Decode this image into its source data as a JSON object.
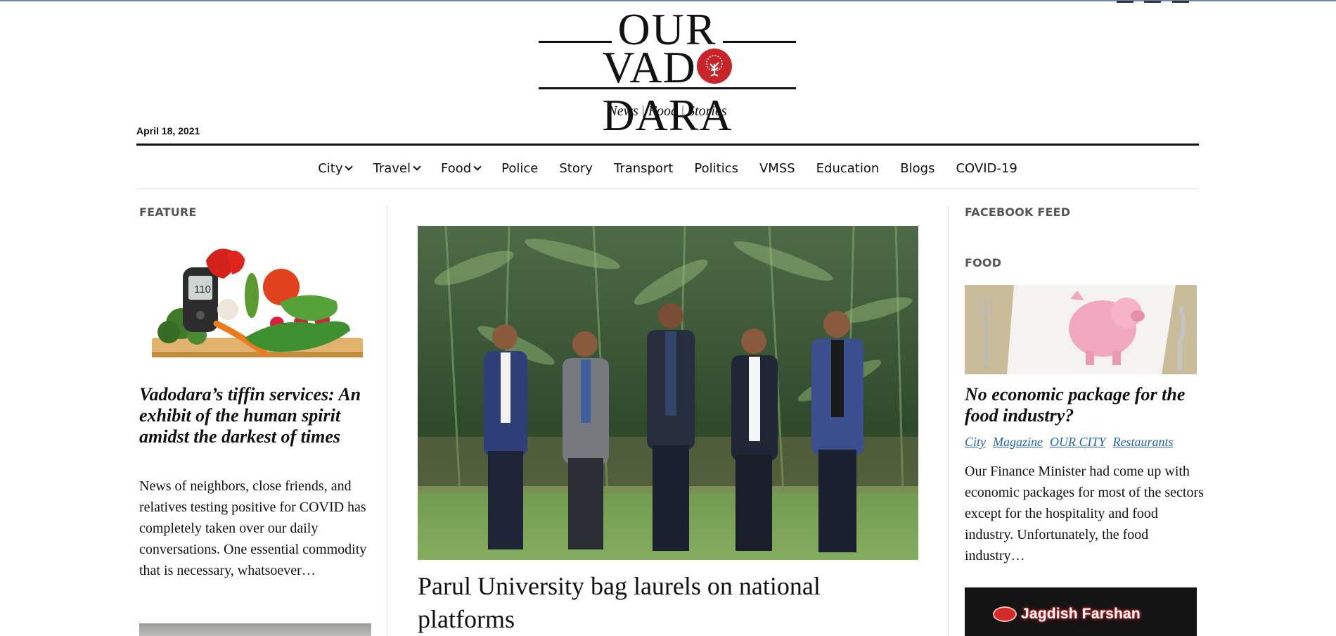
{
  "site": {
    "logo_top": "OUR",
    "logo_bottom_left": "VAD",
    "logo_bottom_right": "DARA",
    "tagline": {
      "a": "News",
      "b": "Food",
      "c": "Stories",
      "sep": "|"
    },
    "date": "April 18, 2021"
  },
  "nav": {
    "items": [
      {
        "label": "City",
        "dropdown": true
      },
      {
        "label": "Travel",
        "dropdown": true
      },
      {
        "label": "Food",
        "dropdown": true
      },
      {
        "label": "Police",
        "dropdown": false
      },
      {
        "label": "Story",
        "dropdown": false
      },
      {
        "label": "Transport",
        "dropdown": false
      },
      {
        "label": "Politics",
        "dropdown": false
      },
      {
        "label": "VMSS",
        "dropdown": false
      },
      {
        "label": "Education",
        "dropdown": false
      },
      {
        "label": "Blogs",
        "dropdown": false
      },
      {
        "label": "COVID-19",
        "dropdown": false
      }
    ]
  },
  "left": {
    "section": "FEATURE",
    "title": "Vadodara’s tiffin services: An exhibit of the human spirit amidst the darkest of times",
    "excerpt": "News of neighbors, close friends, and relatives testing positive for COVID has completely taken over our daily conversations. One essential commodity that is necessary, whatsoever…",
    "glucometer_reading": "110"
  },
  "center": {
    "title": "Parul University bag laurels on national platforms"
  },
  "right": {
    "section_fb": "FACEBOOK FEED",
    "section_food": "FOOD",
    "title": "No economic package for the food industry?",
    "tags": [
      "City",
      "Magazine",
      "OUR CITY",
      "Restaurants"
    ],
    "excerpt": "Our Finance Minister had come up with economic packages for most of the sectors except for the hospitality and food industry. Unfortunately, the food industry…",
    "sign_text": "Jagdish Farshan"
  },
  "colors": {
    "accent_red": "#c9242a",
    "link_blue": "#2563b0",
    "section_gray": "#555555"
  }
}
